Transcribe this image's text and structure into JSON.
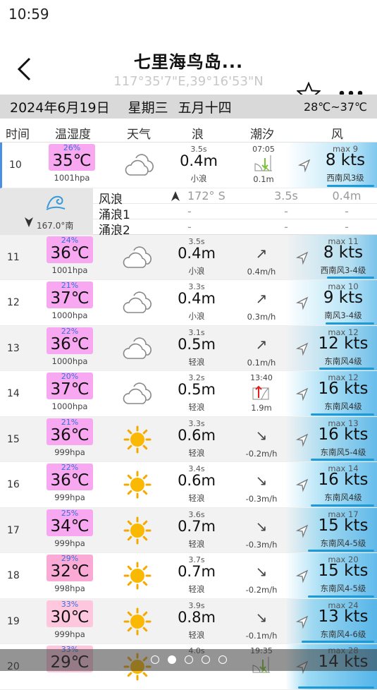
{
  "status": {
    "time": "10:59"
  },
  "header": {
    "title": "七里海鸟岛...",
    "coords": "117°35'7\"E,39°16'53\"N"
  },
  "dateband": {
    "date": "2024年6月19日",
    "weekday": "星期三",
    "lunar": "五月十四",
    "temp_range": "28℃~37℃"
  },
  "columns": {
    "time": "时间",
    "temp_hum": "温湿度",
    "weather": "天气",
    "wave": "浪",
    "tide": "潮汐",
    "wind": "风"
  },
  "detail": {
    "direction": "167.0°南",
    "wind_wave": {
      "label": "风浪",
      "dir": "172° S",
      "period": "3.5s",
      "height": "0.4m"
    },
    "swell1": {
      "label": "涌浪1",
      "dir": "",
      "period": "-",
      "height": "-",
      "dash": "-"
    },
    "swell2": {
      "label": "涌浪2",
      "dir": "",
      "period": "-",
      "height": "-",
      "dash": "-"
    }
  },
  "rows": [
    {
      "time": "10",
      "hum": "26%",
      "temp": "35℃",
      "hpa": "1001hpa",
      "weather": "cloudy",
      "wave_period": "3.5s",
      "wave_height": "0.4m",
      "wave_desc": "小浪",
      "tide_top": "07:05",
      "tide_icon": "low-tide-icon",
      "tide_bottom": "0.1m",
      "wind_max": "max 9",
      "wind_kts": "8 kts",
      "wind_level": "西南风3级",
      "wind_strength": 0.3,
      "alt": false
    },
    {
      "time": "11",
      "hum": "24%",
      "temp": "36℃",
      "hpa": "1001hpa",
      "weather": "cloudy",
      "wave_period": "3.5s",
      "wave_height": "0.4m",
      "wave_desc": "小浪",
      "tide_arrow": "↗",
      "tide_bottom": "0.4m/h",
      "wind_max": "max 11",
      "wind_kts": "8 kts",
      "wind_level": "西南风3-4级",
      "wind_strength": 0.3,
      "alt": true
    },
    {
      "time": "12",
      "hum": "21%",
      "temp": "37℃",
      "hpa": "1000hpa",
      "weather": "cloudy",
      "wave_period": "3.3s",
      "wave_height": "0.4m",
      "wave_desc": "小浪",
      "tide_arrow": "↗",
      "tide_bottom": "0.3m/h",
      "wind_max": "max 10",
      "wind_kts": "9 kts",
      "wind_level": "南风3-4级",
      "wind_strength": 0.32,
      "alt": false
    },
    {
      "time": "13",
      "hum": "22%",
      "temp": "36℃",
      "hpa": "1000hpa",
      "weather": "cloudy",
      "wave_period": "3.1s",
      "wave_height": "0.5m",
      "wave_desc": "轻浪",
      "tide_arrow": "↗",
      "tide_bottom": "0.1m/h",
      "wind_max": "max 12",
      "wind_kts": "12 kts",
      "wind_level": "东南风4级",
      "wind_strength": 0.42,
      "alt": true
    },
    {
      "time": "14",
      "hum": "20%",
      "temp": "37℃",
      "hpa": "1000hpa",
      "weather": "cloudy",
      "wave_period": "3.2s",
      "wave_height": "0.5m",
      "wave_desc": "轻浪",
      "tide_top": "13:40",
      "tide_icon": "high-tide-icon",
      "tide_bottom": "1.9m",
      "wind_max": "max 12",
      "wind_kts": "16 kts",
      "wind_level": "东南风4级",
      "wind_strength": 0.55,
      "alt": false
    },
    {
      "time": "15",
      "hum": "21%",
      "temp": "36℃",
      "hpa": "999hpa",
      "weather": "sunny",
      "wave_period": "3.3s",
      "wave_height": "0.6m",
      "wave_desc": "轻浪",
      "tide_arrow": "↘",
      "tide_bottom": "-0.2m/h",
      "wind_max": "max 13",
      "wind_kts": "16 kts",
      "wind_level": "东南风5-4级",
      "wind_strength": 0.55,
      "alt": true
    },
    {
      "time": "16",
      "hum": "22%",
      "temp": "36℃",
      "hpa": "999hpa",
      "weather": "sunny",
      "wave_period": "3.4s",
      "wave_height": "0.6m",
      "wave_desc": "轻浪",
      "tide_arrow": "↘",
      "tide_bottom": "-0.3m/h",
      "wind_max": "max 14",
      "wind_kts": "16 kts",
      "wind_level": "东南风4级",
      "wind_strength": 0.55,
      "alt": false
    },
    {
      "time": "17",
      "hum": "25%",
      "temp": "34℃",
      "hpa": "999hpa",
      "weather": "sunny",
      "wave_period": "3.6s",
      "wave_height": "0.7m",
      "wave_desc": "轻浪",
      "tide_arrow": "↘",
      "tide_bottom": "-0.3m/h",
      "wind_max": "max 17",
      "wind_kts": "15 kts",
      "wind_level": "东南风4-5级",
      "wind_strength": 0.6,
      "alt": true
    },
    {
      "time": "18",
      "hum": "29%",
      "temp": "32℃",
      "hpa": "998hpa",
      "weather": "sunny",
      "wave_period": "3.7s",
      "wave_height": "0.7m",
      "wave_desc": "轻浪",
      "tide_arrow": "↘",
      "tide_bottom": "-0.2m/h",
      "wind_max": "max 20",
      "wind_kts": "15 kts",
      "wind_level": "东南风4-5级",
      "wind_strength": 0.6,
      "alt": false
    },
    {
      "time": "19",
      "hum": "33%",
      "temp": "30℃",
      "hpa": "999hpa",
      "weather": "sunny",
      "wave_period": "3.9s",
      "wave_height": "0.8m",
      "wave_desc": "轻浪",
      "tide_arrow": "↘",
      "tide_bottom": "-0.1m/h",
      "wind_max": "max 24",
      "wind_kts": "13 kts",
      "wind_level": "东南风4-6级",
      "wind_strength": 0.7,
      "alt": true
    },
    {
      "time": "20",
      "hum": "33%",
      "temp": "29℃",
      "hpa": "",
      "weather": "sunny",
      "wave_period": "4.0s",
      "wave_height": "",
      "wave_desc": "",
      "tide_top": "19:35",
      "tide_icon": "low-tide-icon",
      "tide_bottom": "",
      "wind_max": "max 28",
      "wind_kts": "14 kts",
      "wind_level": "",
      "wind_strength": 0.75,
      "alt": false
    }
  ],
  "pager": {
    "pages": 5,
    "active": 1
  }
}
